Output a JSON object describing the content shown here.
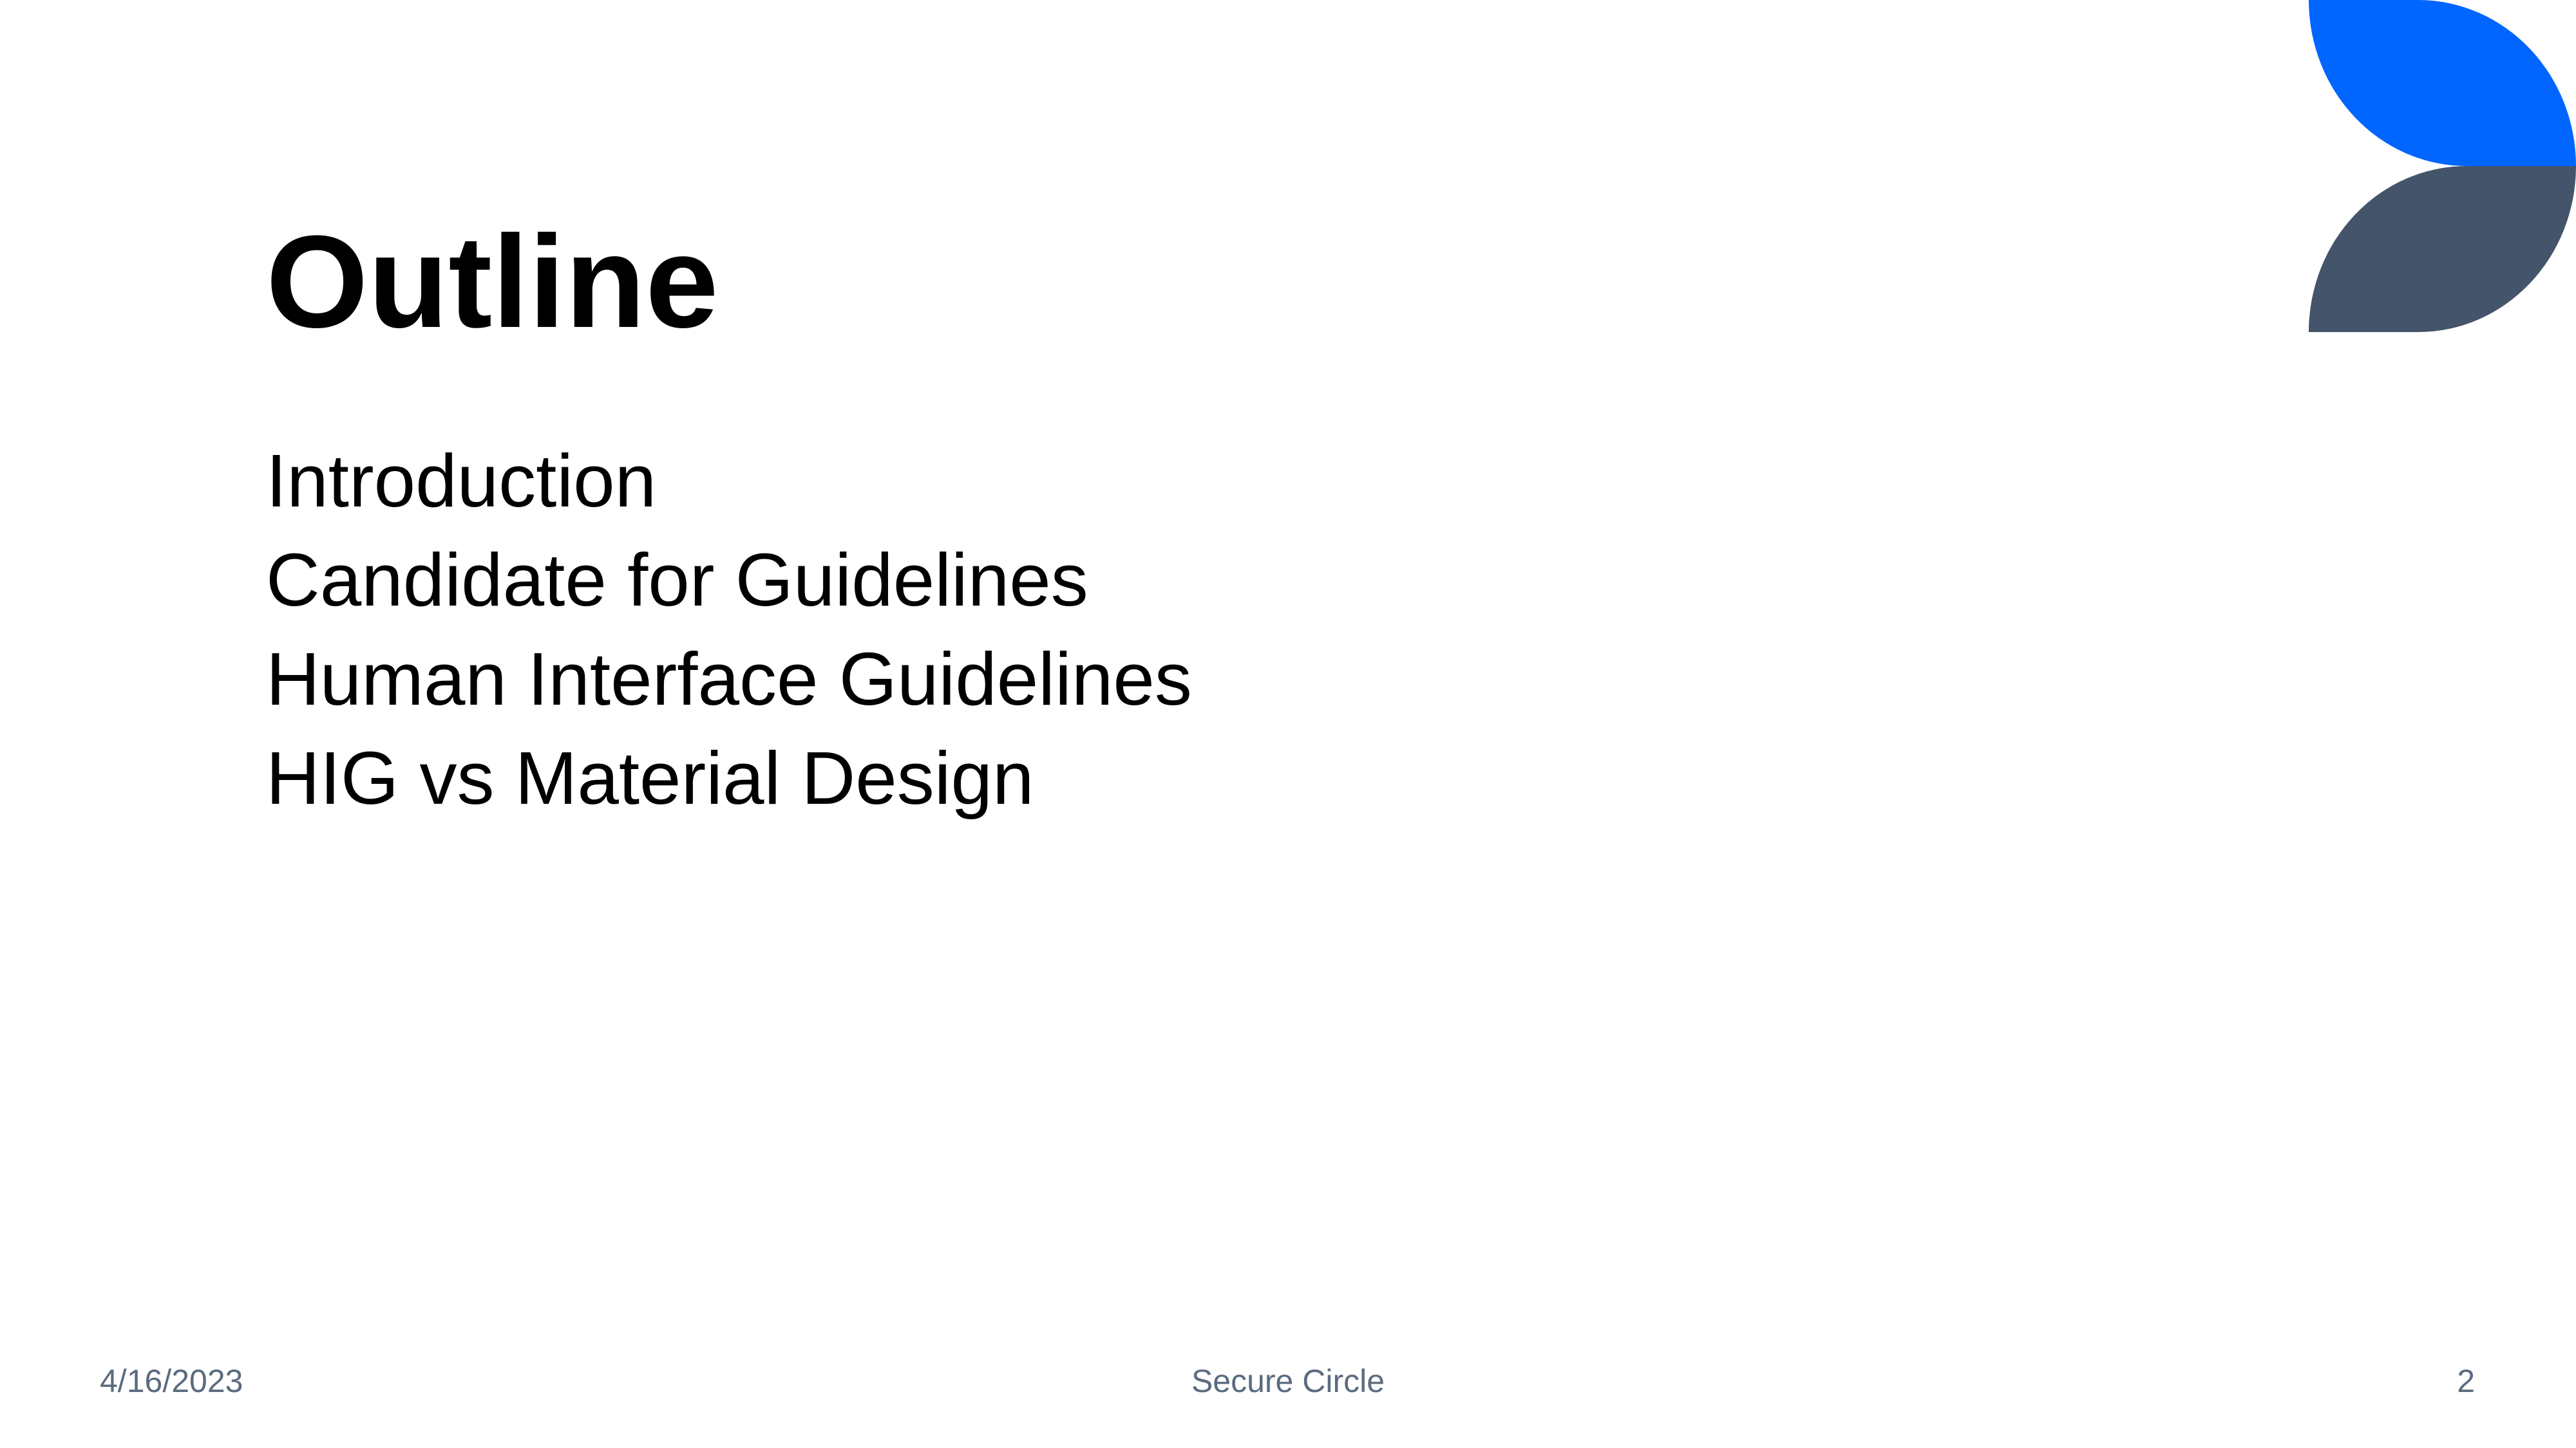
{
  "slide": {
    "title": "Outline",
    "items": [
      "Introduction",
      "Candidate for Guidelines",
      "Human Interface Guidelines",
      "HIG vs Material Design"
    ]
  },
  "footer": {
    "date": "4/16/2023",
    "center": "Secure Circle",
    "page_number": "2"
  },
  "colors": {
    "logo_top": "#0066FF",
    "logo_bottom": "#44546A",
    "footer_text": "#5B6B7F"
  },
  "icons": {
    "logo": "brand-logo-icon"
  }
}
